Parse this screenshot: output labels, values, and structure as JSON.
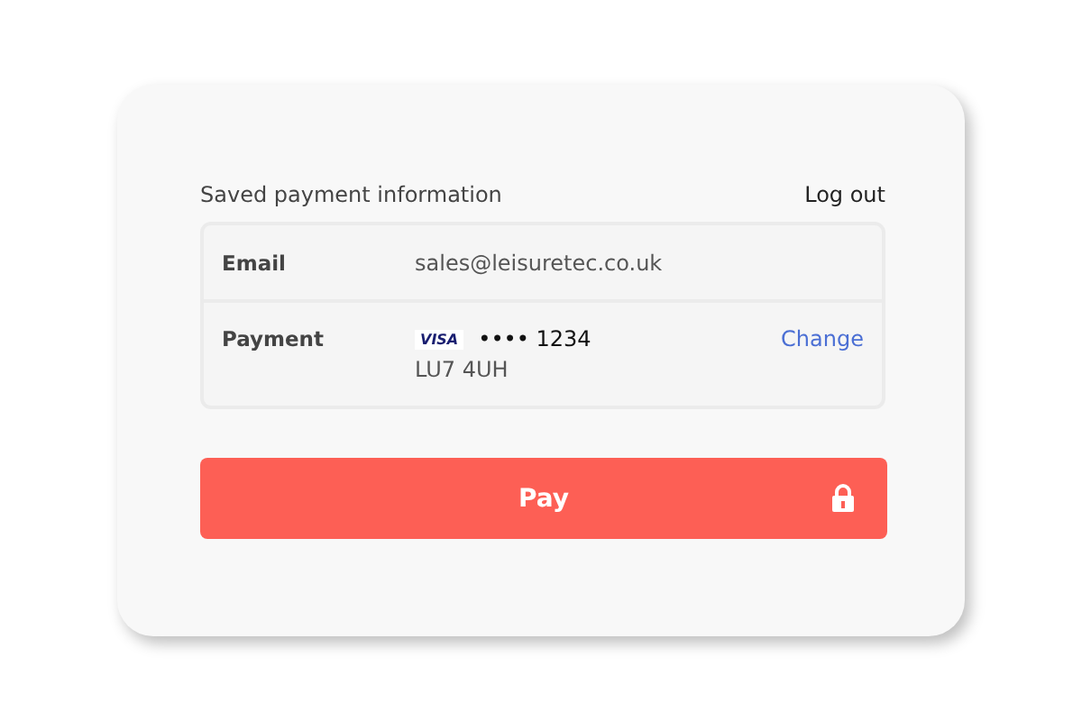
{
  "header": {
    "title": "Saved payment information",
    "action": "Log out"
  },
  "rows": [
    {
      "kind": "email",
      "label": "Email",
      "value": "sales@leisuretec.co.uk"
    },
    {
      "kind": "payment",
      "label": "Payment",
      "brand": "VISA",
      "masked": "•••• 1234",
      "postcode": "LU7 4UH",
      "action": "Change"
    }
  ],
  "pay_button": {
    "label": "Pay"
  }
}
